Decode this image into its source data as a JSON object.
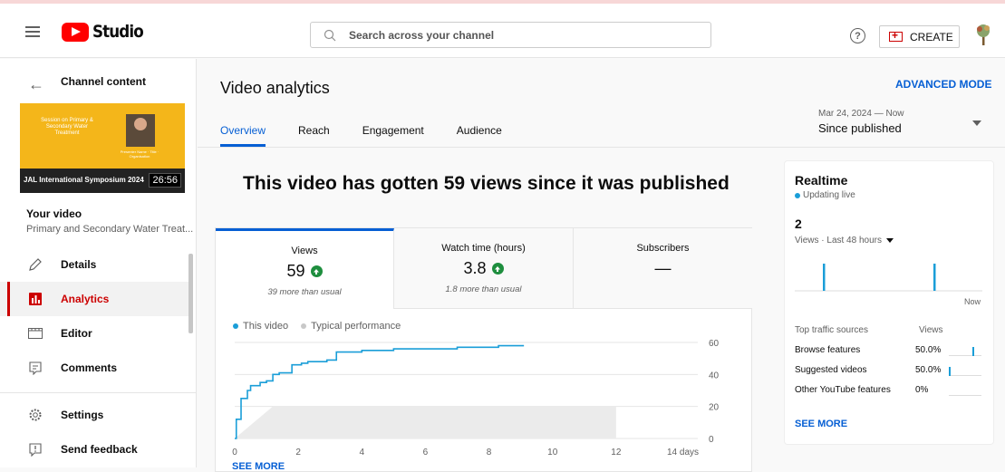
{
  "header": {
    "logo_text": "Studio",
    "search_placeholder": "Search across your channel",
    "help_symbol": "?",
    "create_label": "CREATE"
  },
  "sidebar": {
    "title": "Channel content",
    "thumbnail": {
      "session_text": "Session on Primary & Secondary Water Treatment",
      "presenter_text": "Presenter Name · Title · Organisation",
      "caption": "JAL International Symposium 2024",
      "duration": "26:56"
    },
    "your_video_label": "Your video",
    "video_title": "Primary and Secondary Water Treat...",
    "items": [
      {
        "label": "Details",
        "icon": "pencil-icon"
      },
      {
        "label": "Analytics",
        "icon": "analytics-icon"
      },
      {
        "label": "Editor",
        "icon": "film-icon"
      },
      {
        "label": "Comments",
        "icon": "comment-icon"
      },
      {
        "label": "Settings",
        "icon": "gear-icon"
      },
      {
        "label": "Send feedback",
        "icon": "feedback-icon"
      }
    ]
  },
  "main": {
    "title": "Video analytics",
    "advanced_mode": "ADVANCED MODE",
    "tabs": [
      "Overview",
      "Reach",
      "Engagement",
      "Audience"
    ],
    "date_range": {
      "range": "Mar 24, 2024 — Now",
      "label": "Since published"
    },
    "headline": "This video has gotten 59 views since it was published",
    "metrics": [
      {
        "label": "Views",
        "value": "59",
        "note": "39 more than usual",
        "trend": "up"
      },
      {
        "label": "Watch time (hours)",
        "value": "3.8",
        "note": "1.8 more than usual",
        "trend": "up"
      },
      {
        "label": "Subscribers",
        "value": "—",
        "note": ""
      }
    ],
    "legend": {
      "this_video": "This video",
      "typical": "Typical performance"
    },
    "see_more": "SEE MORE"
  },
  "chart_data": {
    "type": "line",
    "x_tick_labels": [
      "0",
      "2",
      "4",
      "6",
      "8",
      "10",
      "12",
      "14 days"
    ],
    "y_tick_labels": [
      "0",
      "20",
      "40",
      "60"
    ],
    "xlim": [
      0,
      14
    ],
    "ylim": [
      0,
      60
    ],
    "series": [
      {
        "name": "This video",
        "x": [
          0,
          0.05,
          0.2,
          0.4,
          0.5,
          0.8,
          1.0,
          1.2,
          1.4,
          1.6,
          1.8,
          2.1,
          2.3,
          2.6,
          2.9,
          3.2,
          3.5,
          4.0,
          4.5,
          5.0,
          6.0,
          7.0,
          8.0,
          8.3,
          9.1
        ],
        "y": [
          0,
          12,
          25,
          30,
          33,
          35,
          36,
          40,
          41,
          41,
          46,
          47,
          48,
          48,
          49,
          54,
          54,
          55,
          55,
          56,
          56,
          57,
          57,
          58,
          58
        ]
      },
      {
        "name": "Typical performance",
        "band_low": 0,
        "x": [
          0,
          1.2,
          12
        ],
        "y": [
          0,
          20,
          20
        ]
      }
    ],
    "grid": true,
    "legend_position": "top-left"
  },
  "realtime": {
    "title": "Realtime",
    "status": "Updating live",
    "count": "2",
    "subtitle": "Views · Last 48 hours",
    "now_label": "Now",
    "bars": [
      1,
      1
    ],
    "traffic_header": "Top traffic sources",
    "traffic_views_header": "Views",
    "sources": [
      {
        "name": "Browse features",
        "pct": "50.0%",
        "value": 0.5
      },
      {
        "name": "Suggested videos",
        "pct": "50.0%",
        "value": 0.5
      },
      {
        "name": "Other YouTube features",
        "pct": "0%",
        "value": 0
      }
    ],
    "see_more": "SEE MORE"
  },
  "colors": {
    "accent": "#065fd4",
    "brand": "#ff0000",
    "active_nav": "#cc0000",
    "line": "#1a9ed8",
    "up": "#1e8e3e"
  }
}
